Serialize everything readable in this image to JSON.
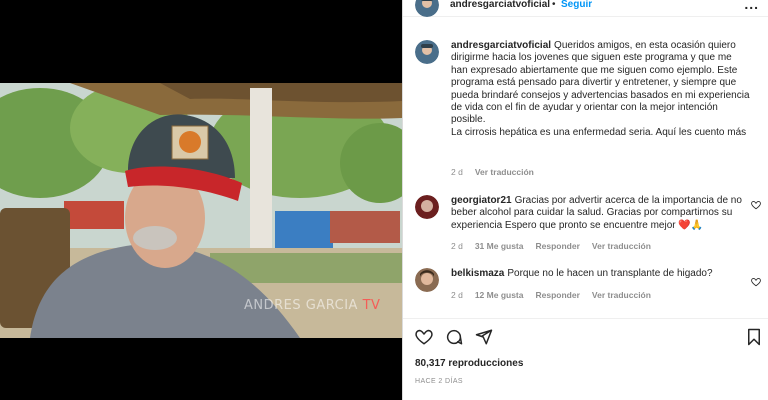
{
  "post": {
    "username": "andresgarciatvoficial",
    "separator": "•",
    "follow_label": "Seguir",
    "more_label": "...",
    "video_watermark_part1": "ANDRES GARCIA ",
    "video_watermark_part2": "TV"
  },
  "caption": {
    "username": "andresgarciatvoficial",
    "text_lines": [
      "Queridos amigos, en esta ocasión quiero dirigirme hacia los jovenes que siguen este programa y que me han expresado abiertamente que me siguen como ejemplo. Este programa está pensado para divertir y entretener, y siempre que pueda brindaré consejos y advertencias basados en mi experiencia de vida con el fin de ayudar y orientar con la mejor intención posible.",
      "La cirrosis hepática es una enfermedad seria. Aquí les cuento más"
    ],
    "time": "2 d",
    "translate_label": "Ver traducción"
  },
  "comments": [
    {
      "username": "georgiator21",
      "text": "Gracias por advertir acerca de la importancia de no beber alcohol para cuidar la salud. Gracias por compartirnos su experiencia Espero que pronto se encuentre mejor",
      "emoji": "❤️🙏",
      "time": "2 d",
      "likes": "31 Me gusta",
      "reply_label": "Responder",
      "translate_label": "Ver traducción"
    },
    {
      "username": "belkismaza",
      "text": "Porque no le hacen un transplante de higado?",
      "time": "2 d",
      "likes": "12 Me gusta",
      "reply_label": "Responder",
      "translate_label": "Ver traducción"
    }
  ],
  "stats": {
    "views": "80,317 reproducciones",
    "posted_ago": "HACE 2 DÍAS"
  },
  "icons": [
    "heart-icon",
    "comment-icon",
    "share-icon",
    "bookmark-icon",
    "more-icon"
  ],
  "colors": {
    "accent": "#0095f6",
    "text": "#262626",
    "muted": "#8e8e8e"
  }
}
